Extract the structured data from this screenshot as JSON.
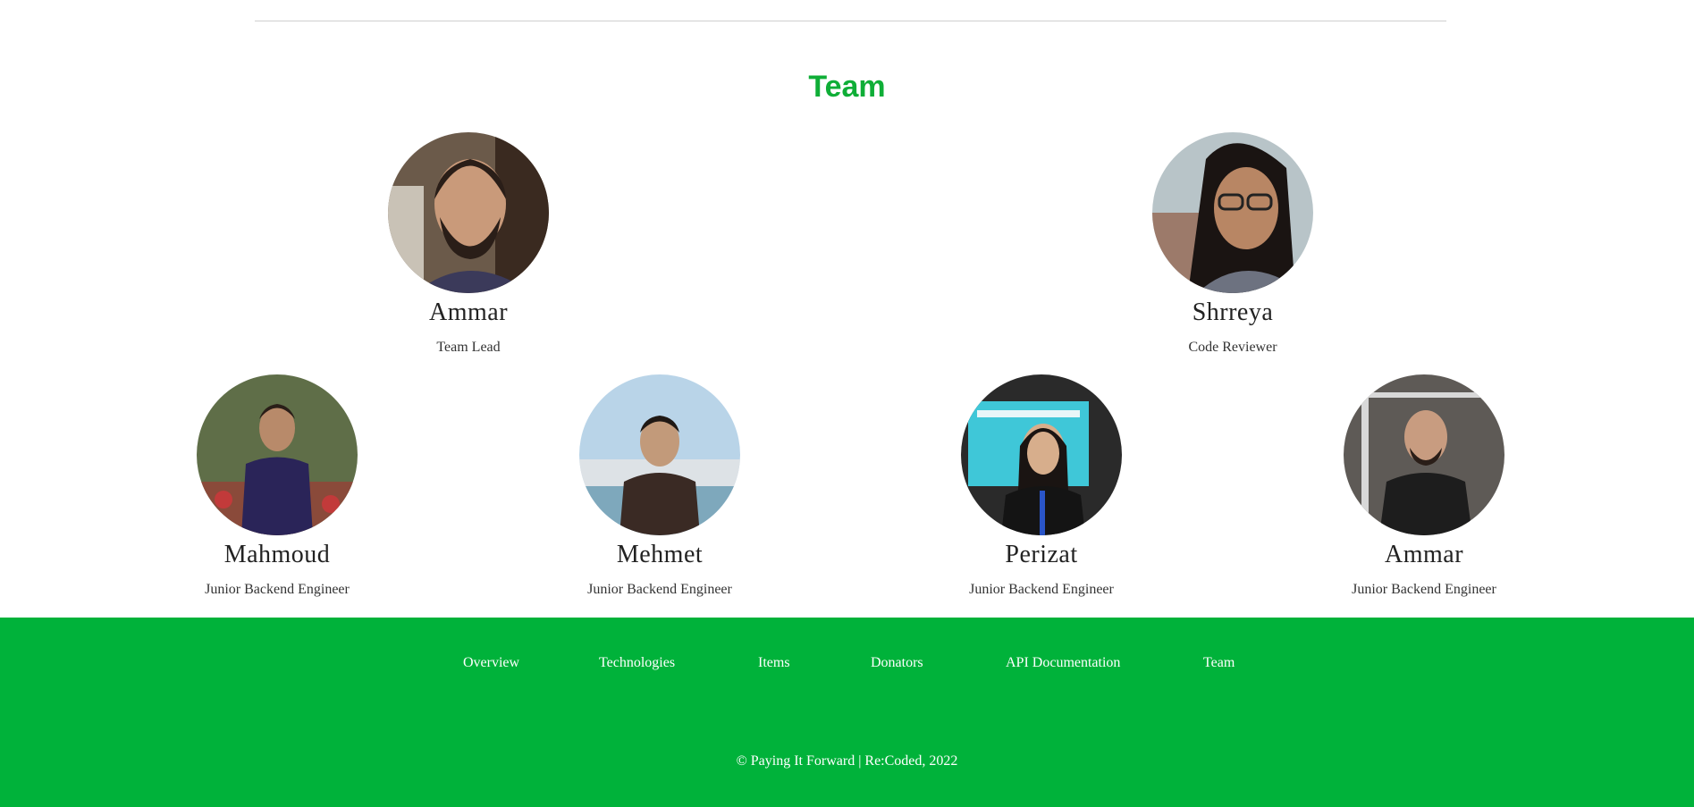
{
  "team": {
    "title": "Team",
    "members": [
      {
        "name": "Ammar",
        "role": "Team Lead",
        "photo": "person-photo"
      },
      {
        "name": "Shrreya",
        "role": "Code Reviewer",
        "photo": "person-photo"
      },
      {
        "name": "Mahmoud",
        "role": "Junior Backend Engineer",
        "photo": "person-photo"
      },
      {
        "name": "Mehmet",
        "role": "Junior Backend Engineer",
        "photo": "person-photo"
      },
      {
        "name": "Perizat",
        "role": "Junior Backend Engineer",
        "photo": "person-photo"
      },
      {
        "name": "Ammar",
        "role": "Junior Backend Engineer",
        "photo": "person-photo"
      }
    ]
  },
  "footer": {
    "nav": [
      "Overview",
      "Technologies",
      "Items",
      "Donators",
      "API Documentation",
      "Team"
    ],
    "copyright": "© Paying It Forward | Re:Coded, 2022"
  },
  "colors": {
    "accent": "#0fae37",
    "footer_bg": "#00b23a"
  }
}
